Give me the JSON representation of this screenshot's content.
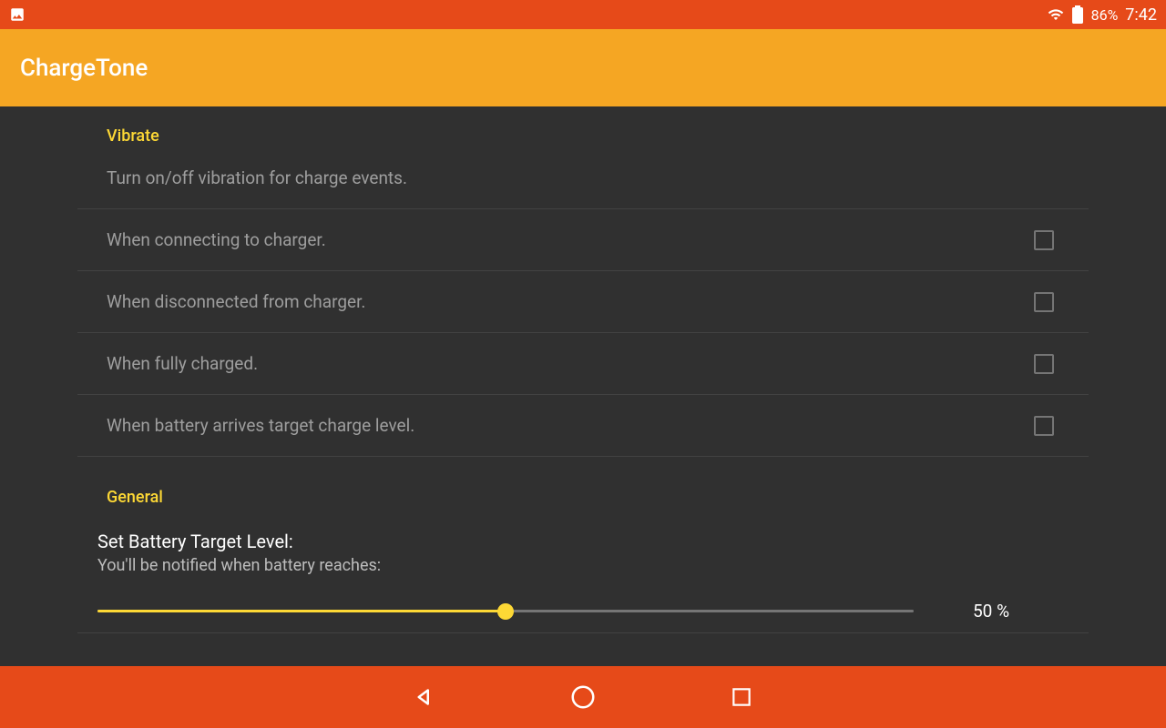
{
  "status_bar": {
    "battery_percent": "86%",
    "time": "7:42"
  },
  "app": {
    "title": "ChargeTone"
  },
  "sections": {
    "vibrate": {
      "title": "Vibrate",
      "description": "Turn on/off vibration for charge events.",
      "items": [
        {
          "label": "When connecting to charger.",
          "checked": false
        },
        {
          "label": "When disconnected from charger.",
          "checked": false
        },
        {
          "label": "When fully charged.",
          "checked": false
        },
        {
          "label": "When battery arrives target charge level.",
          "checked": false
        }
      ]
    },
    "general": {
      "title": "General",
      "target_title": "Set Battery Target Level:",
      "target_desc": "You'll be notified when battery reaches:",
      "target_value": "50 %",
      "target_percent": 50
    }
  }
}
